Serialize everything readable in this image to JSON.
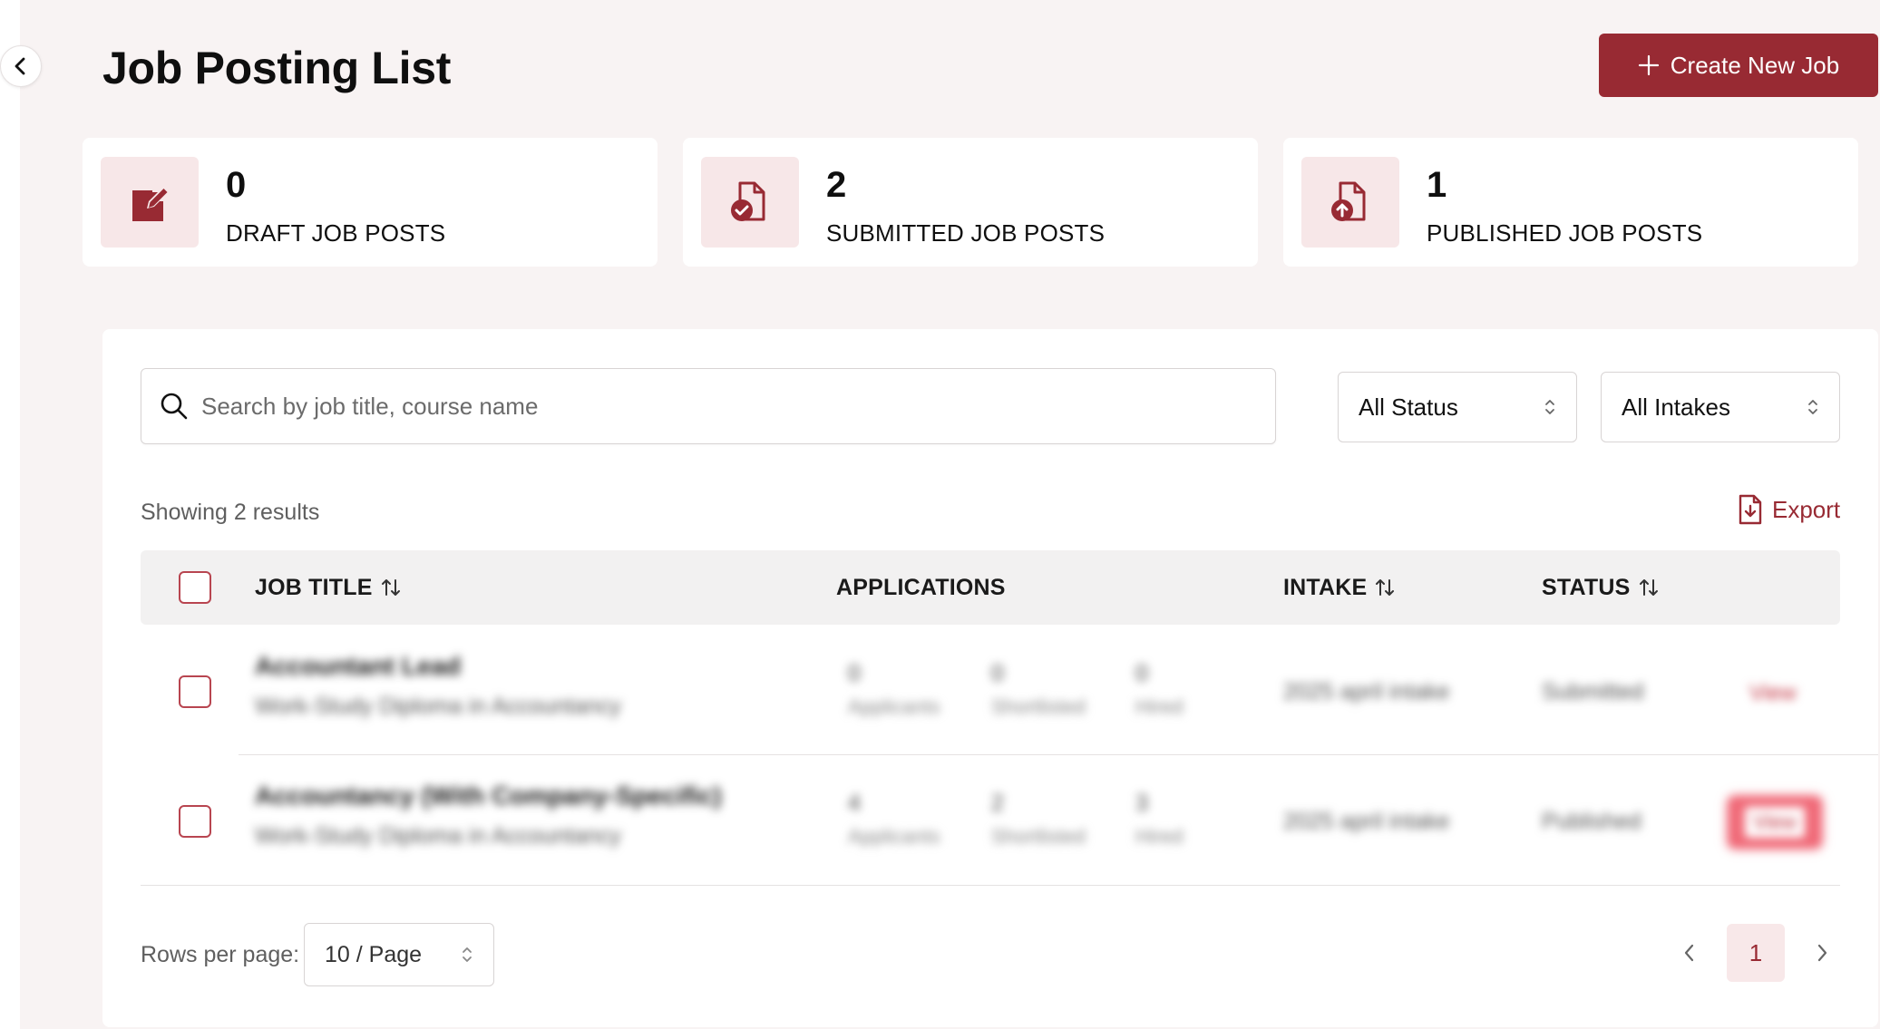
{
  "header": {
    "title": "Job Posting List",
    "create_label": "Create New Job"
  },
  "stats": [
    {
      "value": "0",
      "label": "DRAFT JOB POSTS",
      "icon": "edit-icon"
    },
    {
      "value": "2",
      "label": "SUBMITTED JOB POSTS",
      "icon": "file-check-icon"
    },
    {
      "value": "1",
      "label": "PUBLISHED JOB POSTS",
      "icon": "file-upload-icon"
    }
  ],
  "filters": {
    "search_placeholder": "Search by job title, course name",
    "status": "All Status",
    "intake": "All Intakes"
  },
  "results_text": "Showing 2 results",
  "export_label": "Export",
  "table": {
    "columns": [
      "JOB TITLE",
      "APPLICATIONS",
      "INTAKE",
      "STATUS"
    ],
    "rows": [
      {
        "title": "Accountant Lead",
        "course": "Work-Study Diploma in Accountancy",
        "applicants": "0",
        "applicants_label": "Applicants",
        "shortlisted": "0",
        "shortlisted_label": "Shortlisted",
        "hired": "0",
        "hired_label": "Hired",
        "intake": "2025 april intake",
        "status": "Submitted",
        "action": "View"
      },
      {
        "title": "Accountancy (With Company-Specific)",
        "course": "Work-Study Diploma in Accountancy",
        "applicants": "4",
        "applicants_label": "Applicants",
        "shortlisted": "2",
        "shortlisted_label": "Shortlisted",
        "hired": "3",
        "hired_label": "Hired",
        "intake": "2025 april intake",
        "status": "Published",
        "action": "View"
      }
    ]
  },
  "pagination": {
    "rows_label": "Rows per page:",
    "rows_value": "10 / Page",
    "current_page": "1"
  },
  "colors": {
    "brand": "#982a33",
    "brand_light": "#f7e7e8",
    "background": "#f8f3f3"
  }
}
